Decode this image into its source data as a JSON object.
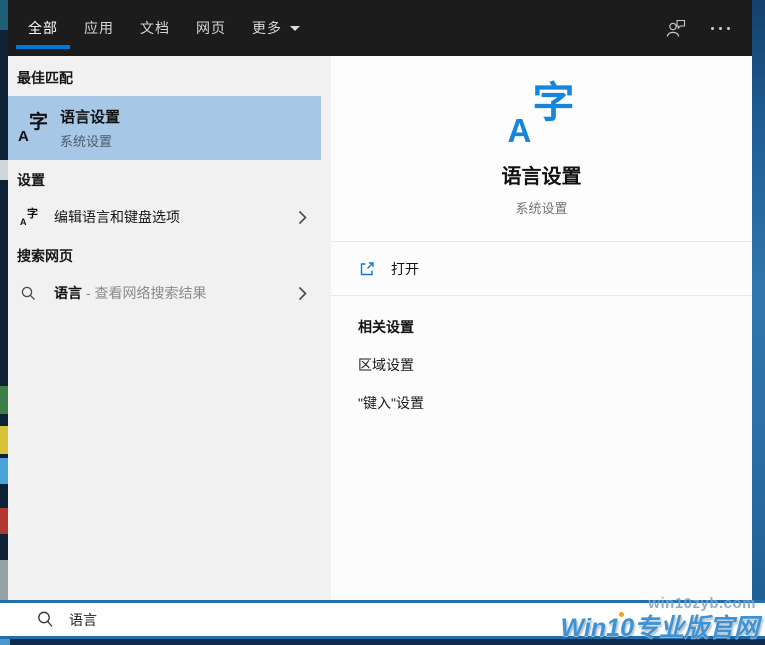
{
  "topbar": {
    "tabs": [
      {
        "label": "全部",
        "selected": true
      },
      {
        "label": "应用",
        "selected": false
      },
      {
        "label": "文档",
        "selected": false
      },
      {
        "label": "网页",
        "selected": false
      },
      {
        "label": "更多",
        "selected": false,
        "has_dropdown": true
      }
    ]
  },
  "left_panel": {
    "best_match_header": "最佳匹配",
    "best_match": {
      "title": "语言设置",
      "subtitle": "系统设置"
    },
    "settings_header": "设置",
    "settings_item": "编辑语言和键盘选项",
    "web_header": "搜索网页",
    "web_item": {
      "query": "语言",
      "suffix": " - 查看网络搜索结果"
    }
  },
  "preview": {
    "title": "语言设置",
    "subtitle": "系统设置",
    "open_label": "打开",
    "related_header": "相关设置",
    "related_items": [
      "区域设置",
      "\"键入\"设置"
    ]
  },
  "search_bar": {
    "query": "语言"
  },
  "watermark": {
    "site": "win10zyb.com",
    "brand": "Win10专业版官网"
  },
  "icons": {
    "glyph_a": "A",
    "glyph_zi": "字"
  },
  "colors": {
    "accent": "#0078d7",
    "selection_blue": "#a6c8e6",
    "topbar_bg": "#1c1c1c",
    "icon_blue": "#1486db",
    "watermark_blue": "#3e92d4",
    "searchbar_border": "#2170ad"
  }
}
